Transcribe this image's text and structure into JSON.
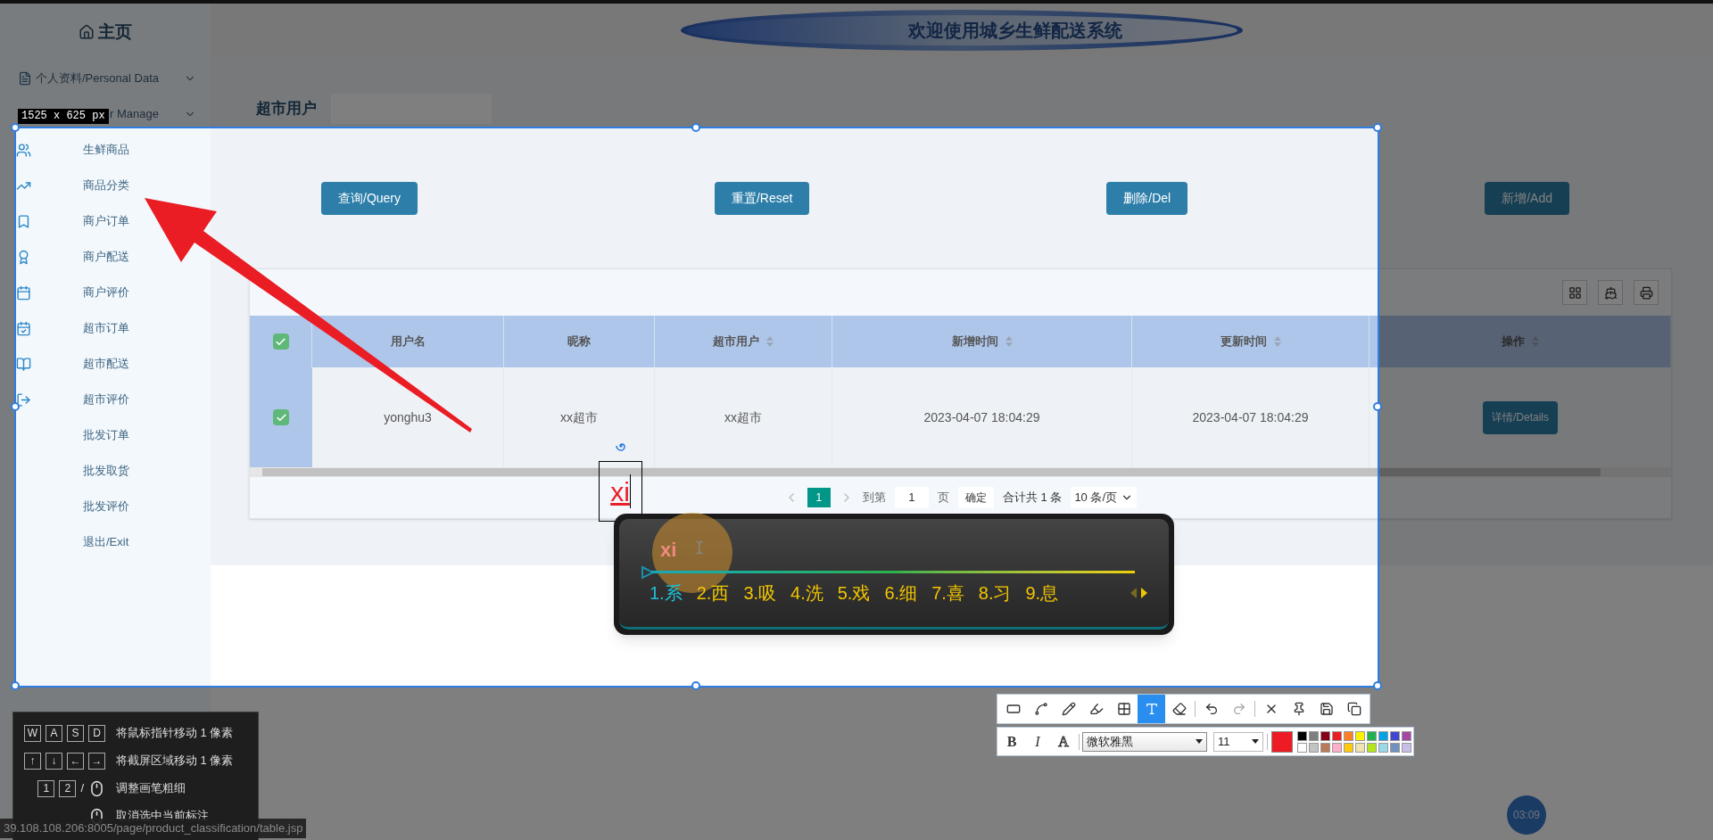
{
  "header": {
    "home": "主页",
    "banner_title": "欢迎使用城乡生鲜配送系统"
  },
  "sidebar": {
    "sections": [
      {
        "label": "个人资料/Personal Data"
      },
      {
        "label": "r Manage"
      }
    ],
    "items": [
      {
        "label": "生鲜商品"
      },
      {
        "label": "商品分类"
      },
      {
        "label": "商户订单"
      },
      {
        "label": "商户配送"
      },
      {
        "label": "商户评价"
      },
      {
        "label": "超市订单"
      },
      {
        "label": "超市配送"
      },
      {
        "label": "超市评价"
      },
      {
        "label": "批发订单"
      },
      {
        "label": "批发取货"
      },
      {
        "label": "批发评价"
      },
      {
        "label": "退出/Exit"
      }
    ]
  },
  "search": {
    "label": "超市用户"
  },
  "buttons": [
    {
      "label": "查询/Query"
    },
    {
      "label": "重置/Reset"
    },
    {
      "label": "删除/Del"
    },
    {
      "label": "新增/Add"
    }
  ],
  "table": {
    "all_checked": true,
    "columns": [
      {
        "label": "用户名",
        "sortable": false
      },
      {
        "label": "昵称",
        "sortable": false
      },
      {
        "label": "超市用户",
        "sortable": true
      },
      {
        "label": "新增时间",
        "sortable": true
      },
      {
        "label": "更新时间",
        "sortable": true
      },
      {
        "label": "操作",
        "sortable": true
      }
    ],
    "rows": [
      {
        "checked": true,
        "cells": [
          "yonghu3",
          "xx超市",
          "xx超市",
          "2023-04-07 18:04:29",
          "2023-04-07 18:04:29"
        ],
        "action": "详情/Details"
      }
    ]
  },
  "pagination": {
    "pages": [
      {
        "label": "1",
        "selected": true
      }
    ],
    "goto_label": "到第",
    "page_input": "1",
    "page_unit": "页",
    "confirm": "确定",
    "total": "合计共 1 条",
    "page_size": "10 条/页"
  },
  "capture": {
    "size_label": "1525 x 625 px",
    "annotation_text": "xi"
  },
  "ime": {
    "composition": "xi",
    "candidates": [
      {
        "label": "1.系",
        "selected": true
      },
      {
        "label": "2.西",
        "selected": false
      },
      {
        "label": "3.吸",
        "selected": false
      },
      {
        "label": "4.洗",
        "selected": false
      },
      {
        "label": "5.戏",
        "selected": false
      },
      {
        "label": "6.细",
        "selected": false
      },
      {
        "label": "7.喜",
        "selected": false
      },
      {
        "label": "8.习",
        "selected": false
      },
      {
        "label": "9.息",
        "selected": false
      }
    ]
  },
  "toolbar": {
    "tools": [
      {
        "selected": false
      },
      {
        "selected": false
      },
      {
        "selected": false
      },
      {
        "selected": false
      },
      {
        "selected": false
      },
      {
        "selected": true
      },
      {
        "selected": false
      }
    ],
    "format_buttons": [
      "B",
      "I",
      "A"
    ],
    "font": "微软雅黑",
    "font_size": "11",
    "current_color": {
      "color": "#ed1c24"
    },
    "palette": [
      {
        "color": "#000000"
      },
      {
        "color": "#7f7f7f"
      },
      {
        "color": "#880015"
      },
      {
        "color": "#ed1c24"
      },
      {
        "color": "#ff7f27"
      },
      {
        "color": "#fff200"
      },
      {
        "color": "#22b14c"
      },
      {
        "color": "#00a2e8"
      },
      {
        "color": "#3f48cc"
      },
      {
        "color": "#a349a4"
      },
      {
        "color": "#ffffff"
      },
      {
        "color": "#c3c3c3"
      },
      {
        "color": "#b97a57"
      },
      {
        "color": "#ffaec9"
      },
      {
        "color": "#ffc90e"
      },
      {
        "color": "#efe4b0"
      },
      {
        "color": "#b5e61d"
      },
      {
        "color": "#99d9ea"
      },
      {
        "color": "#7092be"
      },
      {
        "color": "#c8bfe7"
      }
    ]
  },
  "shortcuts": [
    {
      "kind": "keys",
      "keys": [
        "W",
        "A",
        "S",
        "D"
      ],
      "text": "将鼠标指针移动 1 像素"
    },
    {
      "kind": "keys",
      "keys": [
        "↑",
        "↓",
        "←",
        "→"
      ],
      "text": "将截屏区域移动 1 像素"
    },
    {
      "kind": "keys_wheel",
      "keys": [
        "1",
        "2"
      ],
      "separator": "/",
      "text": "调整画笔粗细"
    },
    {
      "kind": "click",
      "text": "取消选中当前标注"
    }
  ],
  "status_url": "39.108.108.206:8005/page/product_classification/table.jsp",
  "timer": "03:09"
}
